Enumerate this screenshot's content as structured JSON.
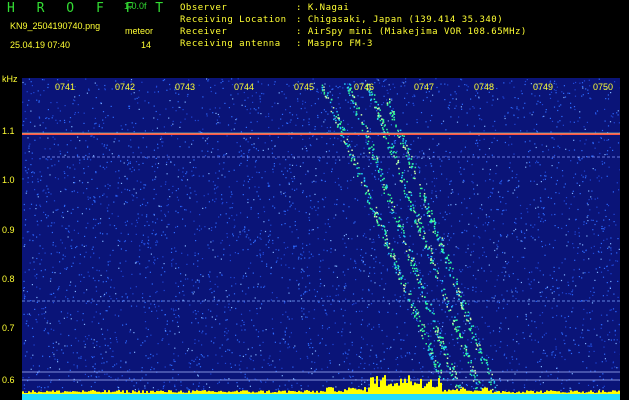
{
  "header": {
    "brand": "H R O F F T",
    "version": "1.0.0f",
    "filename": "KN9_2504190740.png",
    "mode": "meteor",
    "datetime": "25.04.19 07:40",
    "number": "14"
  },
  "info": [
    {
      "label": "Observer",
      "value": ": K.Nagai"
    },
    {
      "label": "Receiving Location",
      "value": ": Chigasaki, Japan (139.414 35.340)"
    },
    {
      "label": "Receiver",
      "value": ": AirSpy mini (Miakejima VOR 108.65MHz)"
    },
    {
      "label": "Receiving antenna",
      "value": ": Maspro FM-3"
    }
  ],
  "spectrogram": {
    "unit_label": "kHz",
    "y_ticks": [
      "1.1",
      "1.0",
      "0.9",
      "0.8",
      "0.7",
      "0.6"
    ],
    "x_ticks": [
      "0741",
      "0742",
      "0743",
      "0744",
      "0745",
      "0746",
      "0747",
      "0748",
      "0749",
      "0750"
    ],
    "colors": {
      "background": "#0a1478",
      "noise": "#2d6bff",
      "signal": "#33ff99",
      "carrier": "#ff4444",
      "level": "#ffff00"
    }
  }
}
